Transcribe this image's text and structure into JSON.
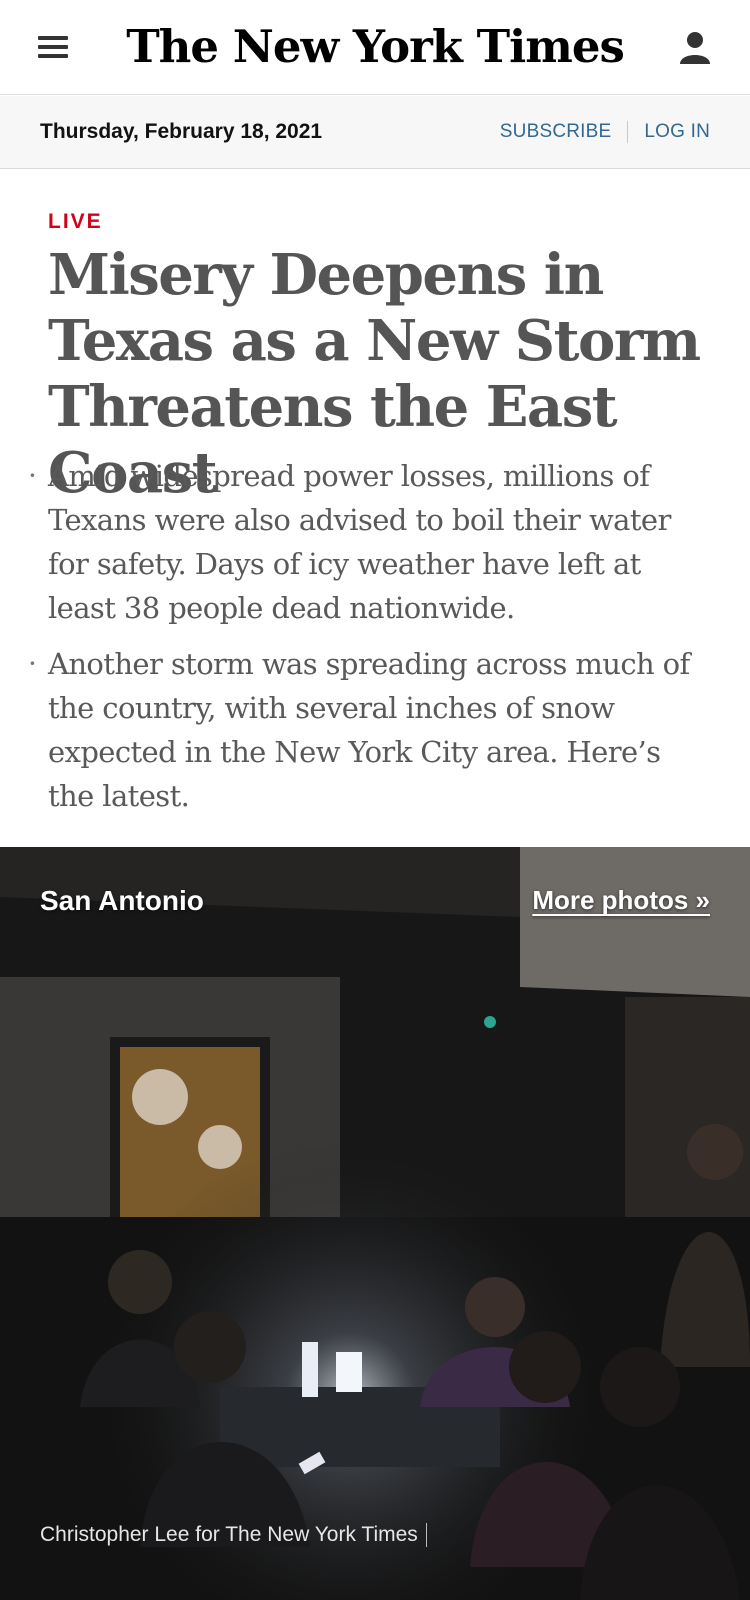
{
  "header": {
    "logo": "The New York Times",
    "menu_icon": "hamburger-menu-icon",
    "account_icon": "user-icon"
  },
  "datebar": {
    "date": "Thursday, February 18, 2021",
    "subscribe": "SUBSCRIBE",
    "login": "LOG IN"
  },
  "article": {
    "kicker": "LIVE",
    "headline": "Misery Deepens in Texas as a New Storm Threatens the East Coast",
    "summary": [
      "Amid widespread power losses, millions of Texans were also advised to boil their water for safety. Days of icy weather have left at least 38 people dead nationwide.",
      "Another storm was spreading across much of the country, with several inches of snow expected in the New York City area. Here’s the latest."
    ]
  },
  "photo": {
    "location": "San Antonio",
    "more_link": "More photos »",
    "credit": "Christopher Lee for The New York Times"
  },
  "colors": {
    "live_red": "#d0021b",
    "link_blue": "#326891",
    "headline_gray": "#555555"
  }
}
